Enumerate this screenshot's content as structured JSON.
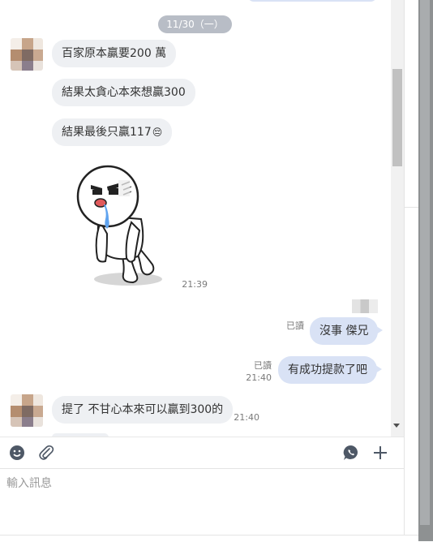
{
  "date_divider": "11/30（一）",
  "messages": [
    {
      "text": "百家原本贏要200 萬"
    },
    {
      "text": "結果太貪心本來想贏300"
    },
    {
      "text": "結果最後只贏117",
      "emoji": "😔"
    },
    {
      "sticker_time": "21:39"
    },
    {
      "text": "沒事 傑兄",
      "read": "已讀"
    },
    {
      "text": "有成功提款了吧",
      "read": "已讀",
      "time": "21:40"
    },
    {
      "text": "提了 不甘心本來可以贏到300的",
      "time": "21:40"
    }
  ],
  "toolbar": {
    "emoji_icon": "smiley-icon",
    "attach_icon": "paperclip-icon",
    "voice_icon": "voice-call-icon",
    "add_icon": "plus-icon"
  },
  "composer": {
    "placeholder": "輸入訊息"
  }
}
